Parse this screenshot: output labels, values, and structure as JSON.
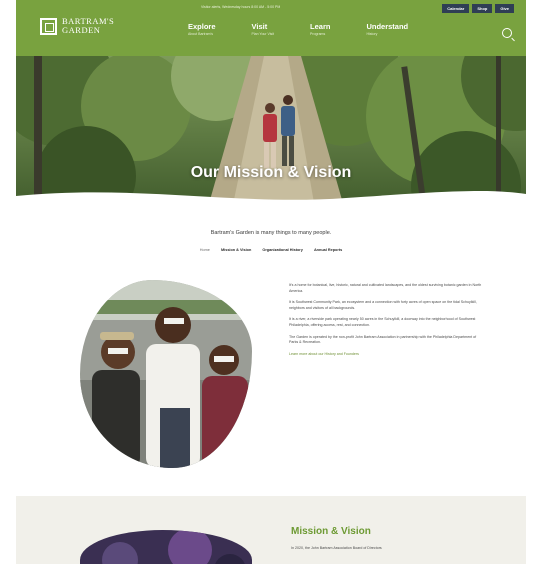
{
  "site": {
    "logo_line1": "BARTRAM'S",
    "logo_line2": "GARDEN",
    "top_notice": "Visitor alerts, Wednesday hours 8:00 AM - 5:00 PM",
    "utility": [
      "Calendar",
      "Shop",
      "Give"
    ],
    "nav": [
      {
        "label": "Explore",
        "sub": "About Bartram's"
      },
      {
        "label": "Visit",
        "sub": "Plan Your Visit"
      },
      {
        "label": "Learn",
        "sub": "Programs"
      },
      {
        "label": "Understand",
        "sub": "History"
      }
    ]
  },
  "hero": {
    "title": "Our Mission & Vision"
  },
  "intro": {
    "tagline": "Bartram's Garden is many things to many people.",
    "subnav": [
      "Home",
      "Mission & Vision",
      "Organizational History",
      "Annual Reports"
    ]
  },
  "main": {
    "paragraphs": [
      "It's a home for botanical, live, historic, natural and cultivated landscapes, and the oldest surviving botanic garden in North America.",
      "It is Southwest Community Park, an ecosystem and a connection with forty acres of open space on the tidal Schuylkill, neighbors and visitors of all backgrounds.",
      "It is a river, a riverside park operating nearly 50 acres in the Schuylkill, a doorway into the neighborhood of Southwest Philadelphia, offering access, rest, and connection.",
      "The Garden is operated by the non-profit John Bartram Association in partnership with the Philadelphia Department of Parks & Recreation."
    ],
    "more_link": "Learn more about our History and Founders"
  },
  "section2": {
    "heading": "Mission & Vision",
    "sub": "In 2020, the John Bartram Association Board of Directors"
  },
  "colors": {
    "brand_green": "#79a23f",
    "utility_navy": "#2f3e54",
    "heading_green": "#6d9a33"
  }
}
